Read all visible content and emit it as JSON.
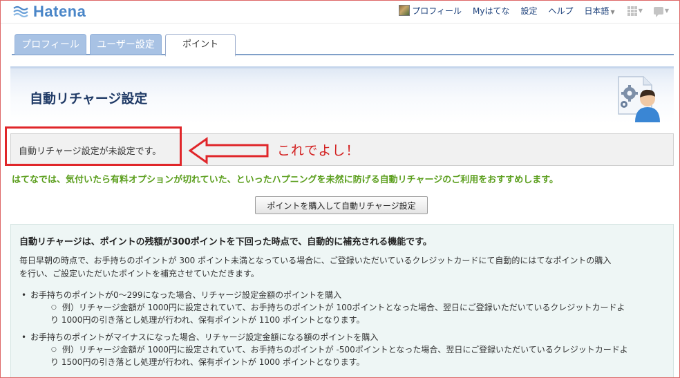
{
  "header": {
    "logo_text": "Hatena",
    "nav": {
      "profile": "プロフィール",
      "my_hatena": "Myはてな",
      "settings": "設定",
      "help": "ヘルプ",
      "language": "日本語"
    }
  },
  "tabs": [
    {
      "label": "プロフィール",
      "active": false
    },
    {
      "label": "ユーザー設定",
      "active": false
    },
    {
      "label": "ポイント",
      "active": true
    }
  ],
  "page": {
    "title": "自動リチャージ設定",
    "status": "自動リチャージ設定が未設定です。",
    "annotation": "これでよし！",
    "recommend": "はてなでは、気付いたら有料オプションが切れていた、といったハプニングを未然に防げる自動リチャージのご利用をおすすめします。",
    "buy_button": "ポイントを購入して自動リチャージ設定"
  },
  "explanation": {
    "lead": "自動リチャージは、ポイントの残額が300ポイントを下回った時点で、自動的に補充される機能です。",
    "para_line1": "毎日早朝の時点で、お手持ちのポイントが 300 ポイント未満となっている場合に、ご登録いただいているクレジットカードにて自動的にはてなポイントの購入",
    "para_line2": "を行い、ご設定いただいたポイントを補充させていただきます。",
    "items": [
      {
        "text": "お手持ちのポイントが0～299になった場合、リチャージ設定金額のポイントを購入",
        "example_line1": "例）リチャージ金額が 1000円に設定されていて、お手持ちのポイントが 100ポイントとなった場合、翌日にご登録いただいているクレジットカードよ",
        "example_line2": "り 1000円の引き落とし処理が行われ、保有ポイントが 1100 ポイントとなります。"
      },
      {
        "text": "お手持ちのポイントがマイナスになった場合、リチャージ設定金額になる額のポイントを購入",
        "example_line1": "例）リチャージ金額が 1000円に設定されていて、お手持ちのポイントが -500ポイントとなった場合、翌日にご登録いただいているクレジットカードよ",
        "example_line2": "り 1500円の引き落とし処理が行われ、保有ポイントが 1000 ポイントとなります。"
      }
    ]
  },
  "colors": {
    "brand": "#4a86c8",
    "title": "#1f3a66",
    "recommend": "#5a9e1c",
    "annotation": "#d32020"
  }
}
